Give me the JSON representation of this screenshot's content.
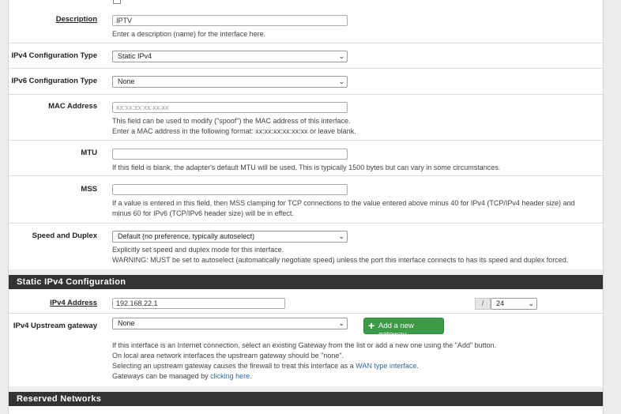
{
  "description": {
    "label": "Description",
    "value": "IPTV",
    "help": "Enter a description (name) for the interface here."
  },
  "ipv4_config": {
    "label": "IPv4 Configuration Type",
    "selected": "Static IPv4"
  },
  "ipv6_config": {
    "label": "IPv6 Configuration Type",
    "selected": "None"
  },
  "mac": {
    "label": "MAC Address",
    "placeholder": "xx:xx:xx:xx:xx:xx",
    "help1": "This field can be used to modify (\"spoof\") the MAC address of this interface.",
    "help2": "Enter a MAC address in the following format: xx:xx:xx:xx:xx:xx or leave blank."
  },
  "mtu": {
    "label": "MTU",
    "value": "",
    "help": "If this field is blank, the adapter's default MTU will be used. This is typically 1500 bytes but can vary in some circumstances."
  },
  "mss": {
    "label": "MSS",
    "value": "",
    "help1": "If a value is entered in this field, then MSS clamping for TCP connections to the value entered above minus 40 for IPv4 (TCP/IPv4 header size) and",
    "help2": "minus 60 for IPv6 (TCP/IPv6 header size) will be in effect."
  },
  "speed": {
    "label": "Speed and Duplex",
    "selected": "Default (no preference, typically autoselect)",
    "help1": "Explicitly set speed and duplex mode for this interface.",
    "help2": "WARNING: MUST be set to autoselect (automatically negotiate speed) unless the port this interface connects to has its speed and duplex forced."
  },
  "static_section": {
    "title": "Static IPv4 Configuration"
  },
  "ipv4_address": {
    "label": "IPv4 Address",
    "value": "192.168.22.1",
    "slash": "/",
    "cidr": "24"
  },
  "gateway": {
    "label": "IPv4 Upstream gateway",
    "selected": "None",
    "add_button": "Add a new gateway",
    "help1": "If this interface is an Internet connection, select an existing Gateway from the list or add a new one using the \"Add\" button.",
    "help2": "On local area network interfaces the upstream gateway should be \"none\".",
    "help3_prefix": "Selecting an upstream gateway causes the firewall to treat this interface as a ",
    "help3_link": "WAN type interface",
    "help3_suffix": ".",
    "help4_prefix": "Gateways can be managed by ",
    "help4_link": "clicking here",
    "help4_suffix": "."
  },
  "reserved_section": {
    "title": "Reserved Networks"
  },
  "icons": {
    "select_arrow": "chevron-down-icon",
    "add": "plus-icon"
  },
  "colors": {
    "header_bg": "#333333",
    "accent_green": "#3d9a47",
    "link": "#2f6aa6"
  }
}
